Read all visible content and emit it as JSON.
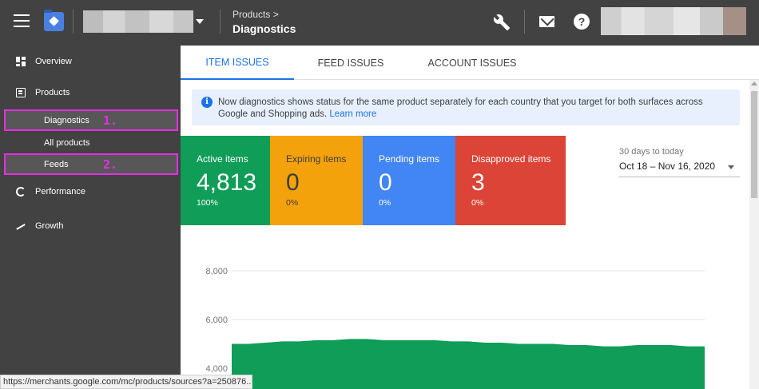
{
  "header": {
    "breadcrumb_parent": "Products >",
    "title": "Diagnostics"
  },
  "sidebar": {
    "items": [
      {
        "label": "Overview",
        "icon": "overview-icon"
      },
      {
        "label": "Products",
        "icon": "products-icon"
      },
      {
        "label": "Diagnostics",
        "annotation": "1."
      },
      {
        "label": "All products"
      },
      {
        "label": "Feeds",
        "annotation": "2."
      },
      {
        "label": "Performance",
        "icon": "performance-icon"
      },
      {
        "label": "Growth",
        "icon": "growth-icon"
      }
    ],
    "highlight_color": "#e62ee6"
  },
  "tabs": [
    {
      "label": "ITEM ISSUES",
      "active": true
    },
    {
      "label": "FEED ISSUES",
      "active": false
    },
    {
      "label": "ACCOUNT ISSUES",
      "active": false
    }
  ],
  "banner": {
    "text": "Now diagnostics shows status for the same product separately for each country that you target for both surfaces across Google and Shopping ads.",
    "link": "Learn more"
  },
  "stats": [
    {
      "label": "Active items",
      "value": "4,813",
      "percent": "100%",
      "color": "#0f9d58"
    },
    {
      "label": "Expiring items",
      "value": "0",
      "percent": "0%",
      "color": "#f4a20b"
    },
    {
      "label": "Pending items",
      "value": "0",
      "percent": "0%",
      "color": "#4285f4"
    },
    {
      "label": "Disapproved items",
      "value": "3",
      "percent": "0%",
      "color": "#db4437"
    }
  ],
  "date_range": {
    "caption": "30 days to today",
    "value": "Oct 18 – Nov 16, 2020"
  },
  "chart_data": {
    "type": "area",
    "title": "",
    "xlabel": "",
    "ylabel": "",
    "ylim": [
      3800,
      8600
    ],
    "yticks": [
      8000,
      6000,
      4000
    ],
    "ytick_labels": [
      "8,000",
      "6,000",
      "4,000"
    ],
    "grid": true,
    "series": [
      {
        "color": "#0f9d58",
        "values": [
          5000,
          5000,
          5050,
          5100,
          5100,
          5150,
          5150,
          5200,
          5200,
          5150,
          5150,
          5150,
          5150,
          5100,
          5100,
          5050,
          5050,
          5000,
          5000,
          5000,
          4950,
          4950,
          4900,
          4900,
          4950,
          4950,
          4950,
          4900,
          4900
        ]
      }
    ]
  },
  "statusbar": "https://merchants.google.com/mc/products/sources?a=250876..."
}
